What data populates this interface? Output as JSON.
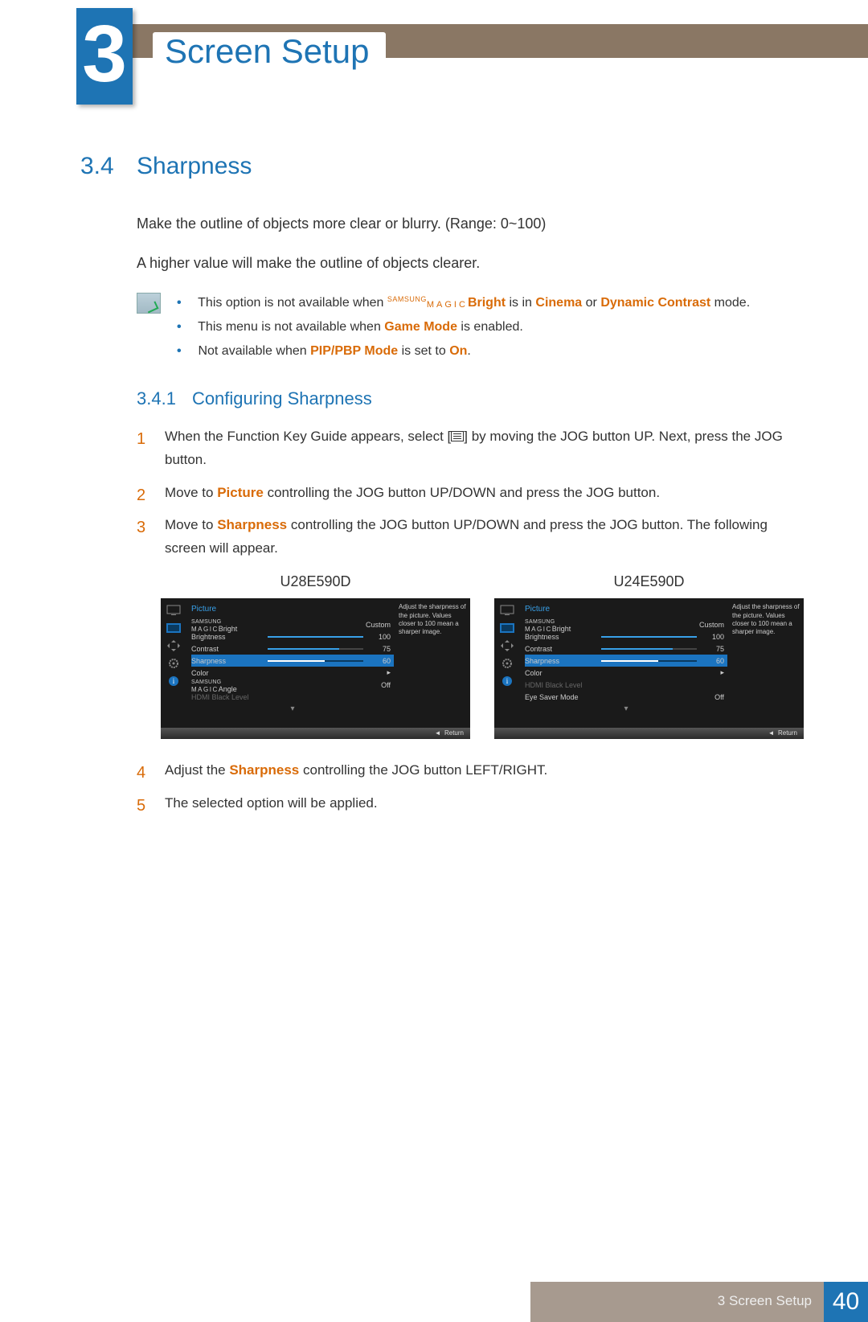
{
  "chapter": {
    "number": "3",
    "title": "Screen Setup"
  },
  "section": {
    "number": "3.4",
    "title": "Sharpness"
  },
  "intro": {
    "p1": "Make the outline of objects more clear or blurry. (Range: 0~100)",
    "p2": "A higher value will make the outline of objects clearer."
  },
  "notes": {
    "n1_pre": "This option is not available when ",
    "n1_magic_top": "SAMSUNG",
    "n1_magic_bot": "MAGIC",
    "n1_b": "Bright",
    "n1_mid": " is in ",
    "n1_o1": "Cinema",
    "n1_or": " or ",
    "n1_o2": "Dynamic Contrast",
    "n1_end": " mode.",
    "n2_pre": "This menu is not available when ",
    "n2_o": "Game Mode",
    "n2_end": " is enabled.",
    "n3_pre": "Not available when ",
    "n3_o": "PIP/PBP Mode",
    "n3_mid": " is set to ",
    "n3_o2": "On",
    "n3_end": "."
  },
  "subsection": {
    "number": "3.4.1",
    "title": "Configuring Sharpness"
  },
  "steps": {
    "s1a": "When the Function Key Guide appears, select [",
    "s1b": "] by moving the JOG button UP. Next, press the JOG button.",
    "s2a": "Move to ",
    "s2o": "Picture",
    "s2b": " controlling the JOG button UP/DOWN and press the JOG button.",
    "s3a": "Move to ",
    "s3o": "Sharpness",
    "s3b": " controlling the JOG button UP/DOWN and press the JOG button. The following screen will appear.",
    "s4a": "Adjust the ",
    "s4o": "Sharpness",
    "s4b": " controlling the JOG button LEFT/RIGHT.",
    "s5": "The selected option will be applied."
  },
  "osd": {
    "modelA": "U28E590D",
    "modelB": "U24E590D",
    "side": "Adjust the sharpness of the picture. Values closer to 100 mean a sharper image.",
    "header": "Picture",
    "magic_top": "SAMSUNG",
    "magic_bot": "MAGIC",
    "magic_bright": "Bright",
    "magic_angle": "Angle",
    "custom": "Custom",
    "off": "Off",
    "brightness": "Brightness",
    "brightness_v": "100",
    "contrast": "Contrast",
    "contrast_v": "75",
    "sharpness": "Sharpness",
    "sharpness_v": "60",
    "color": "Color",
    "hdmi": "HDMI Black Level",
    "eye": "Eye Saver Mode",
    "return": "Return",
    "arrow": "◄"
  },
  "footer": {
    "chapter": "3 Screen Setup",
    "page": "40"
  }
}
